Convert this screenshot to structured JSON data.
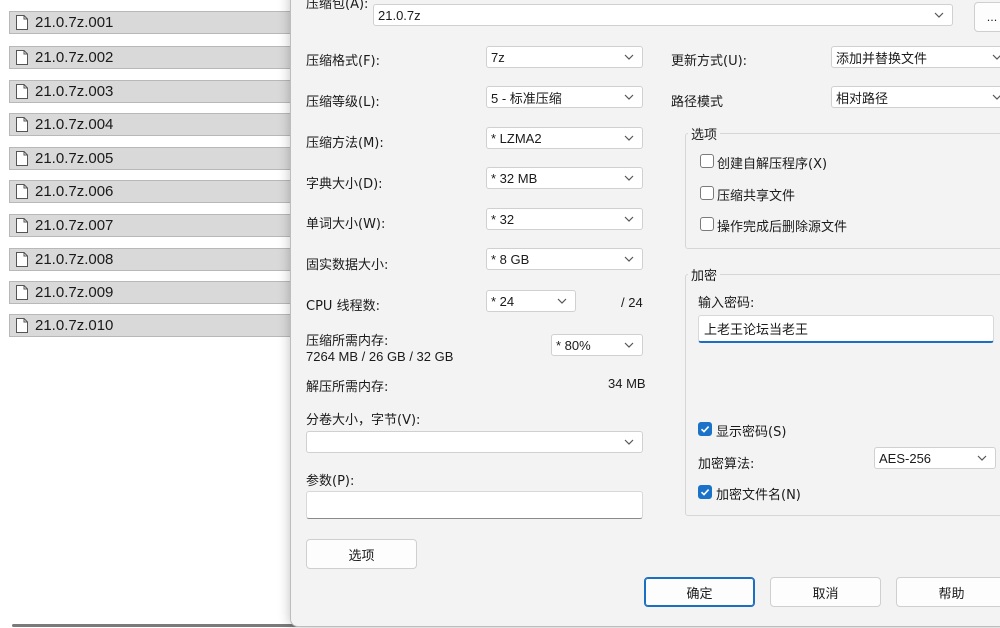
{
  "file_list": {
    "files": [
      "21.0.7z.001",
      "21.0.7z.002",
      "21.0.7z.003",
      "21.0.7z.004",
      "21.0.7z.005",
      "21.0.7z.006",
      "21.0.7z.007",
      "21.0.7z.008",
      "21.0.7z.009",
      "21.0.7z.010"
    ]
  },
  "dialog": {
    "archive": {
      "label": "压缩包(A):",
      "value": "21.0.7z",
      "browse_label": "..."
    },
    "left": {
      "format": {
        "label": "压缩格式(F):",
        "value": "7z"
      },
      "level": {
        "label": "压缩等级(L):",
        "value": "5 - 标准压缩"
      },
      "method": {
        "label": "压缩方法(M):",
        "value": "* LZMA2"
      },
      "dictionary": {
        "label": "字典大小(D):",
        "value": "* 32 MB"
      },
      "word": {
        "label": "单词大小(W):",
        "value": "* 32"
      },
      "solid": {
        "label": "固实数据大小:",
        "value": "* 8 GB"
      },
      "threads": {
        "label": "CPU 线程数:",
        "value": "* 24",
        "max": "/ 24"
      },
      "mem_compress": {
        "label": "压缩所需内存:",
        "detail": "7264 MB / 26 GB / 32 GB",
        "value": "* 80%"
      },
      "mem_decompress": {
        "label": "解压所需内存:",
        "value": "34 MB"
      },
      "volume": {
        "label": "分卷大小，字节(V):",
        "value": ""
      },
      "params": {
        "label": "参数(P):",
        "value": ""
      },
      "options_button": "选项"
    },
    "right": {
      "update": {
        "label": "更新方式(U):",
        "value": "添加并替换文件"
      },
      "path": {
        "label": "路径模式",
        "value": "相对路径"
      },
      "options_group": {
        "title": "选项",
        "sfx": "创建自解压程序(X)",
        "shared": "压缩共享文件",
        "delete": "操作完成后删除源文件"
      },
      "encryption": {
        "title": "加密",
        "password_label": "输入密码:",
        "password_value": "上老王论坛当老王",
        "show_password": "显示密码(S)",
        "method_label": "加密算法:",
        "method_value": "AES-256",
        "encrypt_names": "加密文件名(N)"
      }
    },
    "buttons": {
      "ok": "确定",
      "cancel": "取消",
      "help": "帮助"
    }
  },
  "colors": {
    "accent": "#1a73c8",
    "dialog_bg": "#f3f3f3",
    "row_bg": "#d9d9d9"
  }
}
